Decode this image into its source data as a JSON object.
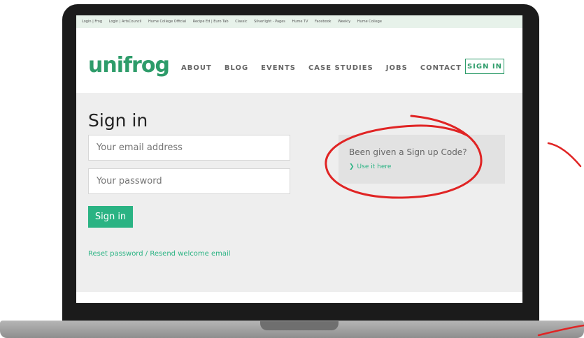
{
  "bookmarks": [
    "Login | Frog",
    "Login | ArtsCouncil",
    "Hume College Official",
    "Recipe Ed | Euro Tab",
    "Classic",
    "Silverlight - Pages",
    "Hume TV",
    "Facebook",
    "Weekly",
    "Hume College"
  ],
  "brand": {
    "name": "unifrog",
    "accent": "#2e9c6a"
  },
  "nav": {
    "items": [
      "ABOUT",
      "BLOG",
      "EVENTS",
      "CASE STUDIES",
      "JOBS",
      "CONTACT"
    ],
    "signin_label": "SIGN IN"
  },
  "page": {
    "title": "Sign in"
  },
  "form": {
    "email_placeholder": "Your email address",
    "password_placeholder": "Your password",
    "submit_label": "Sign in",
    "reset_link": "Reset password / Resend welcome email"
  },
  "signup": {
    "prompt": "Been given a Sign up Code?",
    "link_label": "Use it here"
  },
  "icons": {
    "chevron": "chevron-right-icon"
  },
  "colors": {
    "green": "#2ab383",
    "annotation": "#e02424"
  }
}
